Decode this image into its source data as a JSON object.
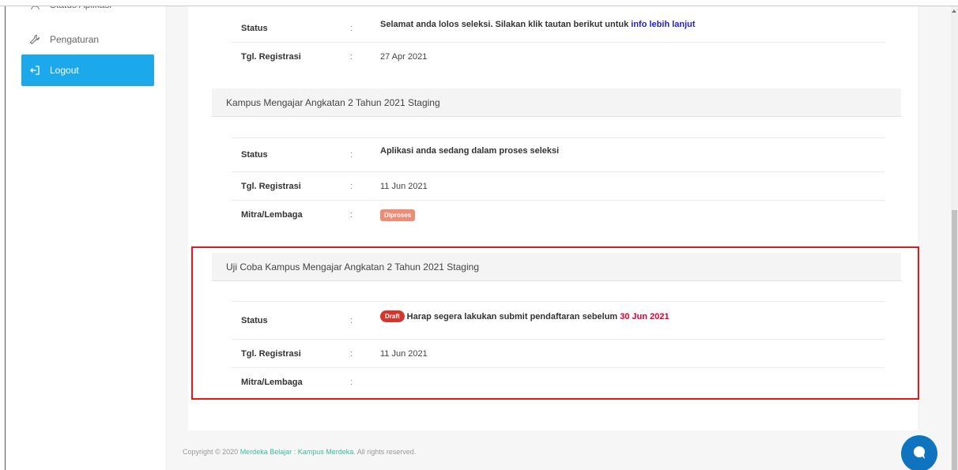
{
  "sidebar": {
    "partial_item": "Status Aplikasi",
    "settings_label": "Pengaturan",
    "logout_label": "Logout",
    "settings_icon": "wrench-icon",
    "logout_icon": "logout-icon"
  },
  "programs": [
    {
      "title": "",
      "status_label": "Status",
      "status_text": "Selamat anda lolos seleksi. Silakan klik tautan berikut untuk ",
      "status_link": "info lebih lanjut",
      "reg_label": "Tgl. Registrasi",
      "reg_date": "27 Apr 2021"
    },
    {
      "title": "Kampus Mengajar Angkatan 2 Tahun 2021 Staging",
      "status_label": "Status",
      "status_text": "Aplikasi anda sedang dalam proses seleksi",
      "reg_label": "Tgl. Registrasi",
      "reg_date": "11 Jun 2021",
      "mitra_label": "Mitra/Lembaga",
      "mitra_badge": "Diproses"
    },
    {
      "title": "Uji Coba Kampus Mengajar Angkatan 2 Tahun 2021 Staging",
      "status_label": "Status",
      "status_badge": "Draft",
      "status_text": "Harap segera lakukan submit pendaftaran sebelum ",
      "status_deadline": "30 Jun 2021",
      "reg_label": "Tgl. Registrasi",
      "reg_date": "11 Jun 2021",
      "mitra_label": "Mitra/Lembaga",
      "mitra_value": ""
    }
  ],
  "colon": ":",
  "footer": {
    "prefix": "Copyright © 2020 ",
    "brand": "Merdeka Belajar : Kampus Merdeka",
    "suffix": ". All rights reserved."
  },
  "colors": {
    "accent": "#1ba9ec",
    "link": "#2323c8",
    "deadline": "#e4002b",
    "badge_diproses": "#f28b74",
    "badge_draft": "#d9342b",
    "highlight": "#e6161d",
    "chat": "#0f74c0"
  },
  "chat_icon": "chat-bubble-icon"
}
